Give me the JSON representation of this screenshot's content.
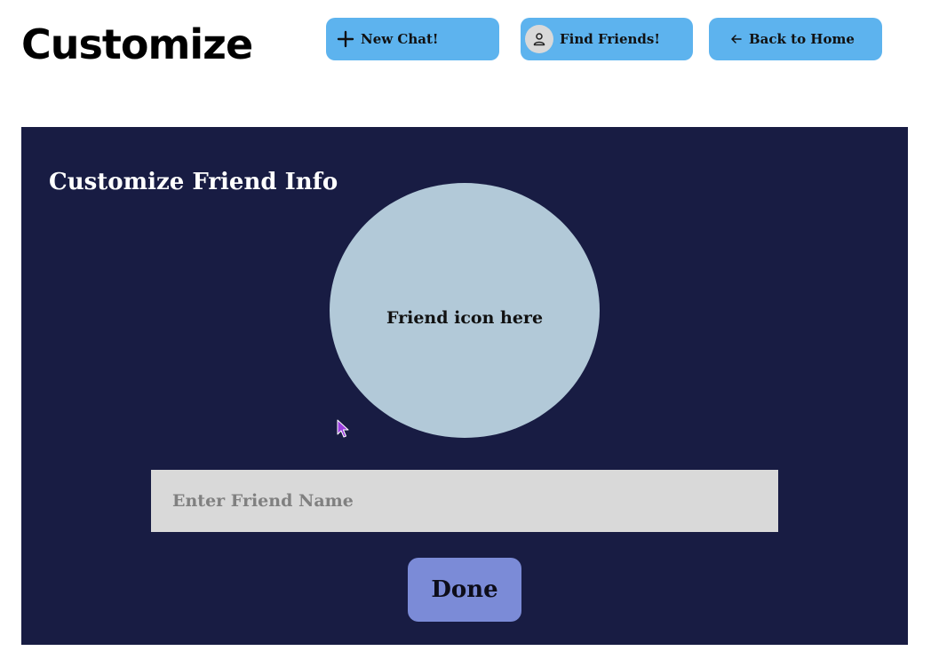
{
  "header": {
    "title": "Customize",
    "buttons": {
      "new_chat": {
        "label": "New Chat!",
        "icon": "plus-icon"
      },
      "find_friends": {
        "label": "Find Friends!",
        "icon": "person-icon"
      },
      "back_home": {
        "label": "Back to Home",
        "icon": "arrow-left-icon"
      }
    }
  },
  "panel": {
    "title": "Customize Friend Info",
    "friend_icon_text": "Friend icon here",
    "name_input": {
      "value": "",
      "placeholder": "Enter Friend Name"
    },
    "done_label": "Done"
  },
  "colors": {
    "button_blue": "#5db3ee",
    "panel_bg": "#181c43",
    "friend_icon_bg": "#b2c9d8",
    "input_bg": "#d9d9d9",
    "done_bg": "#7b8bd7",
    "cursor": "#9b3fe0"
  }
}
